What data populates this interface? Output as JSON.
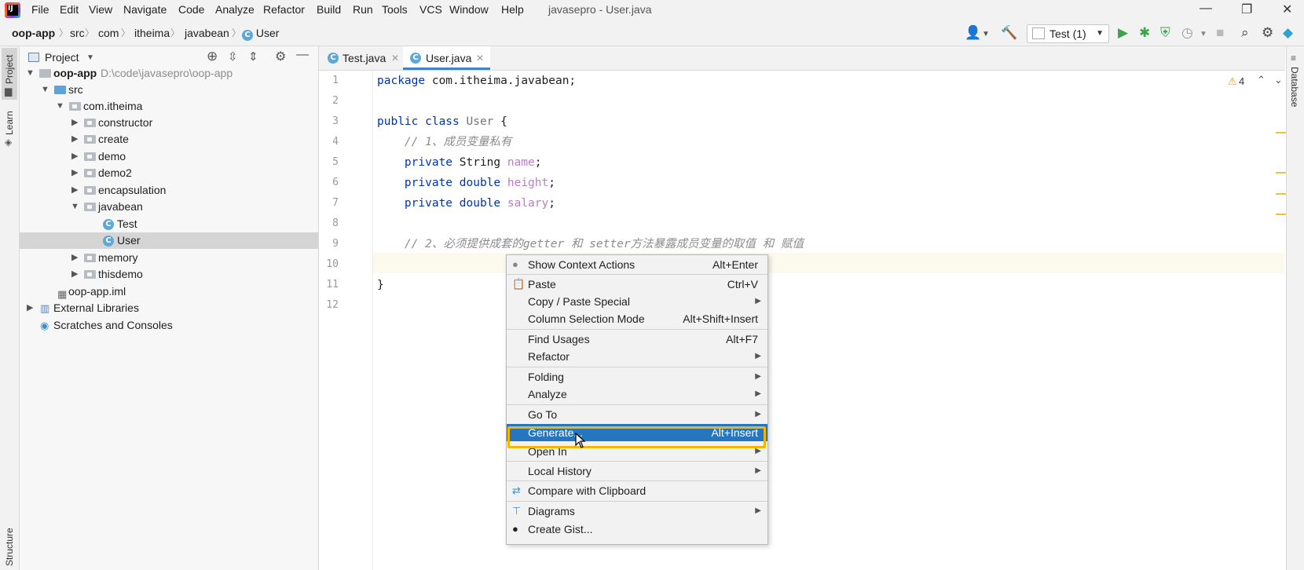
{
  "menubar": {
    "items": [
      "File",
      "Edit",
      "View",
      "Navigate",
      "Code",
      "Analyze",
      "Refactor",
      "Build",
      "Run",
      "Tools",
      "VCS",
      "Window",
      "Help"
    ],
    "window_title": "javasepro - User.java"
  },
  "breadcrumb": [
    "oop-app",
    "src",
    "com",
    "itheima",
    "javabean",
    "User"
  ],
  "toolbar": {
    "run_config": "Test (1)",
    "icons": [
      "user-icon",
      "build-hammer-icon",
      "run-icon",
      "debug-icon",
      "coverage-icon",
      "profile-icon",
      "stop-icon",
      "search-icon",
      "settings-icon",
      "plugin-icon"
    ]
  },
  "left_stripe": {
    "project": "Project",
    "learn": "Learn",
    "structure": "Structure"
  },
  "right_stripe": {
    "database": "Database"
  },
  "project_panel": {
    "title": "Project",
    "root_name": "oop-app",
    "root_path": "D:\\code\\javasepro\\oop-app",
    "tree": [
      {
        "label": "src"
      },
      {
        "label": "com.itheima"
      },
      {
        "label": "constructor"
      },
      {
        "label": "create"
      },
      {
        "label": "demo"
      },
      {
        "label": "demo2"
      },
      {
        "label": "encapsulation"
      },
      {
        "label": "javabean"
      },
      {
        "label": "Test"
      },
      {
        "label": "User"
      },
      {
        "label": "memory"
      },
      {
        "label": "thisdemo"
      },
      {
        "label": "oop-app.iml"
      },
      {
        "label": "External Libraries"
      },
      {
        "label": "Scratches and Consoles"
      }
    ]
  },
  "editor": {
    "tabs": [
      {
        "label": "Test.java"
      },
      {
        "label": "User.java"
      }
    ],
    "warning_count": "4",
    "line_numbers": [
      "1",
      "2",
      "3",
      "4",
      "5",
      "6",
      "7",
      "8",
      "9",
      "10",
      "11",
      "12"
    ],
    "code": {
      "l1_kw": "package",
      "l1_rest": " com.itheima.javabean;",
      "l3_kw": "public class",
      "l3_cls": " User",
      "l3_rest": " {",
      "l4_cmt": "    // 1、成员变量私有",
      "l5_kw": "    private",
      "l5_type": " String",
      "l5_fld": " name",
      "l5_end": ";",
      "l6_kw": "    private double",
      "l6_fld": " height",
      "l6_end": ";",
      "l7_kw": "    private double",
      "l7_fld": " salary",
      "l7_end": ";",
      "l9_cmt": "    // 2、必须提供成套的getter 和 setter方法暴露成员变量的取值 和 赋值",
      "l11": "}"
    }
  },
  "context_menu": {
    "items": [
      {
        "label": "Show Context Actions",
        "shortcut": "Alt+Enter"
      },
      {
        "label": "Paste",
        "shortcut": "Ctrl+V"
      },
      {
        "label": "Copy / Paste Special"
      },
      {
        "label": "Column Selection Mode",
        "shortcut": "Alt+Shift+Insert"
      },
      {
        "label": "Find Usages",
        "shortcut": "Alt+F7"
      },
      {
        "label": "Refactor"
      },
      {
        "label": "Folding"
      },
      {
        "label": "Analyze"
      },
      {
        "label": "Go To"
      },
      {
        "label": "Generate...",
        "shortcut": "Alt+Insert"
      },
      {
        "label": "Open In"
      },
      {
        "label": "Local History"
      },
      {
        "label": "Compare with Clipboard"
      },
      {
        "label": "Diagrams"
      },
      {
        "label": "Create Gist..."
      }
    ]
  },
  "colors": {
    "accent": "#2675bf",
    "highlight_box": "#f5b400",
    "keyword": "#0033b3"
  }
}
